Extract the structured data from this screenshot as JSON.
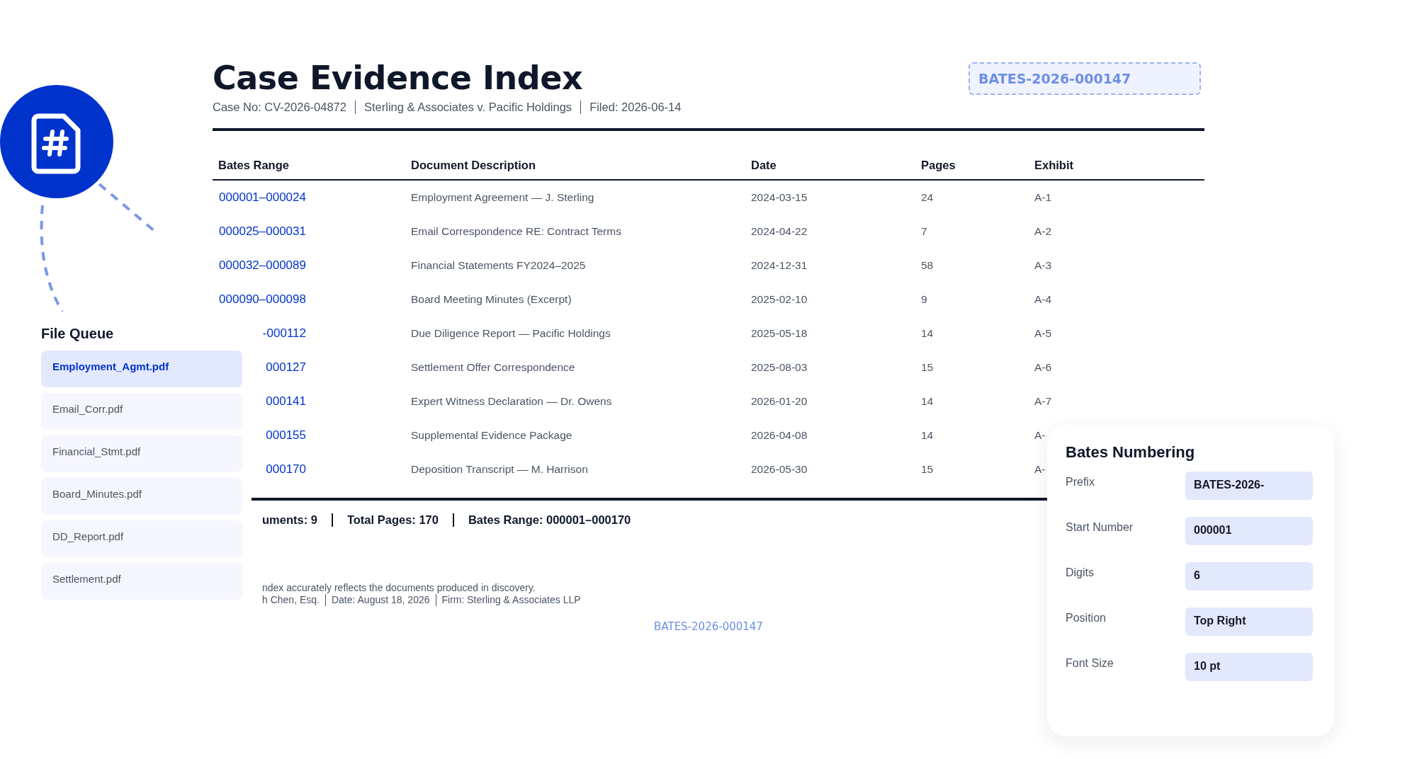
{
  "document": {
    "title": "Case Evidence Index",
    "stamp": "BATES-2026-000147",
    "meta": [
      "Case No: CV-2026-04872",
      "Sterling & Associates v. Pacific Holdings",
      "Filed: 2026-06-14"
    ]
  },
  "table": {
    "columns": [
      "Bates Range",
      "Document Description",
      "Date",
      "Pages",
      "Exhibit"
    ],
    "rows": [
      {
        "bates": "000001–000024",
        "description": "Employment Agreement — J. Sterling",
        "date": "2024-03-15",
        "pages": "24",
        "exhibit": "A-1"
      },
      {
        "bates": "000025–000031",
        "description": "Email Correspondence RE: Contract Terms",
        "date": "2024-04-22",
        "pages": "7",
        "exhibit": "A-2"
      },
      {
        "bates": "000032–000089",
        "description": "Financial Statements FY2024–2025",
        "date": "2024-12-31",
        "pages": "58",
        "exhibit": "A-3"
      },
      {
        "bates": "000090–000098",
        "description": "Board Meeting Minutes (Excerpt)",
        "date": "2025-02-10",
        "pages": "9",
        "exhibit": "A-4"
      },
      {
        "bates": "-000112",
        "description": "Due Diligence Report — Pacific Holdings",
        "date": "2025-05-18",
        "pages": "14",
        "exhibit": "A-5"
      },
      {
        "bates": "000127",
        "description": "Settlement Offer Correspondence",
        "date": "2025-08-03",
        "pages": "15",
        "exhibit": "A-6"
      },
      {
        "bates": "000141",
        "description": "Expert Witness Declaration — Dr. Owens",
        "date": "2026-01-20",
        "pages": "14",
        "exhibit": "A-7"
      },
      {
        "bates": "000155",
        "description": "Supplemental Evidence Package",
        "date": "2026-04-08",
        "pages": "14",
        "exhibit": "A-"
      },
      {
        "bates": "000170",
        "description": "Deposition Transcript — M. Harrison",
        "date": "2026-05-30",
        "pages": "15",
        "exhibit": "A-"
      }
    ]
  },
  "totals": [
    "uments: 9",
    "Total Pages: 170",
    "Bates Range: 000001–000170"
  ],
  "certification": {
    "statement": "ndex accurately reflects the documents produced in discovery.",
    "details": [
      "h Chen, Esq.",
      "Date: August 18, 2026",
      "Firm: Sterling & Associates LLP"
    ]
  },
  "footer_stamp": "BATES-2026-000147",
  "file_queue": {
    "title": "File Queue",
    "items": [
      {
        "name": "Employment_Agmt.pdf",
        "selected": true
      },
      {
        "name": "Email_Corr.pdf",
        "selected": false
      },
      {
        "name": "Financial_Stmt.pdf",
        "selected": false
      },
      {
        "name": "Board_Minutes.pdf",
        "selected": false
      },
      {
        "name": "DD_Report.pdf",
        "selected": false
      },
      {
        "name": "Settlement.pdf",
        "selected": false
      }
    ]
  },
  "bates_panel": {
    "title": "Bates Numbering",
    "fields": [
      {
        "label": "Prefix",
        "value": "BATES-2026-"
      },
      {
        "label": "Start Number",
        "value": "000001"
      },
      {
        "label": "Digits",
        "value": "6"
      },
      {
        "label": "Position",
        "value": "Top Right"
      },
      {
        "label": "Font Size",
        "value": "10 pt"
      }
    ]
  }
}
